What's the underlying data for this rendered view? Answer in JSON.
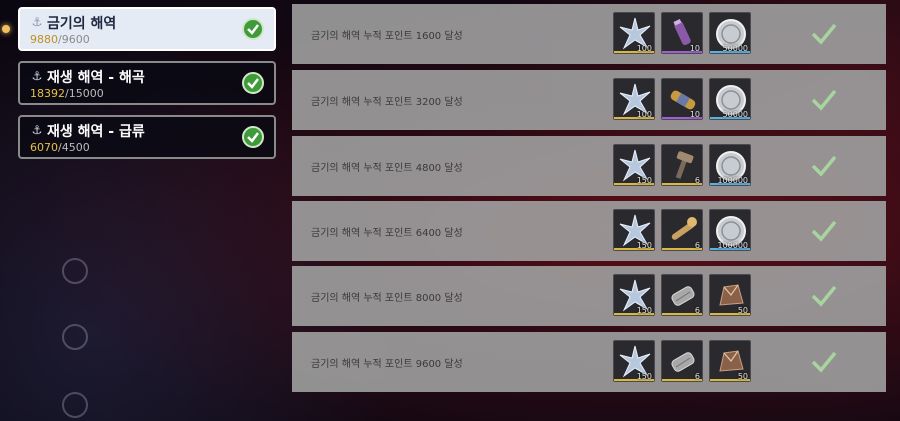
{
  "categories": [
    {
      "title": "금기의 해역",
      "current": "9880",
      "max": "9600",
      "active": true
    },
    {
      "title": "재생 해역 - 해곡",
      "current": "18392",
      "max": "15000",
      "active": false
    },
    {
      "title": "재생 해역 - 급류",
      "current": "6070",
      "max": "4500",
      "active": false
    }
  ],
  "progress_separator": "/",
  "rewards": [
    {
      "label": "금기의 해역 누적 포인트 1600 달성",
      "items": [
        {
          "icon": "star-shard-icon",
          "qty": "100"
        },
        {
          "icon": "purple-vial-icon",
          "qty": "10"
        },
        {
          "icon": "silver-coin-icon",
          "qty": "50000"
        }
      ]
    },
    {
      "label": "금기의 해역 누적 포인트 3200 달성",
      "items": [
        {
          "icon": "star-shard-icon",
          "qty": "100"
        },
        {
          "icon": "gold-capsule-icon",
          "qty": "10"
        },
        {
          "icon": "silver-coin-icon",
          "qty": "50000"
        }
      ]
    },
    {
      "label": "금기의 해역 누적 포인트 4800 달성",
      "items": [
        {
          "icon": "star-shard-icon",
          "qty": "150"
        },
        {
          "icon": "hammer-tool-icon",
          "qty": "6"
        },
        {
          "icon": "silver-coin-icon",
          "qty": "100000"
        }
      ]
    },
    {
      "label": "금기의 해역 누적 포인트 6400 달성",
      "items": [
        {
          "icon": "star-shard-icon",
          "qty": "150"
        },
        {
          "icon": "wrench-tool-icon",
          "qty": "6"
        },
        {
          "icon": "silver-coin-icon",
          "qty": "100000"
        }
      ]
    },
    {
      "label": "금기의 해역 누적 포인트 8000 달성",
      "items": [
        {
          "icon": "star-shard-icon",
          "qty": "150"
        },
        {
          "icon": "metal-canister-icon",
          "qty": "6"
        },
        {
          "icon": "leather-pouch-icon",
          "qty": "50"
        }
      ]
    },
    {
      "label": "금기의 해역 누적 포인트 9600 달성",
      "items": [
        {
          "icon": "star-shard-icon",
          "qty": "150"
        },
        {
          "icon": "metal-canister-icon",
          "qty": "6"
        },
        {
          "icon": "leather-pouch-icon",
          "qty": "50"
        }
      ]
    }
  ],
  "colors": {
    "completed_check": "#a8d4a0",
    "progress_current": "#e8c040",
    "row_bg": "#a0a0a0"
  }
}
